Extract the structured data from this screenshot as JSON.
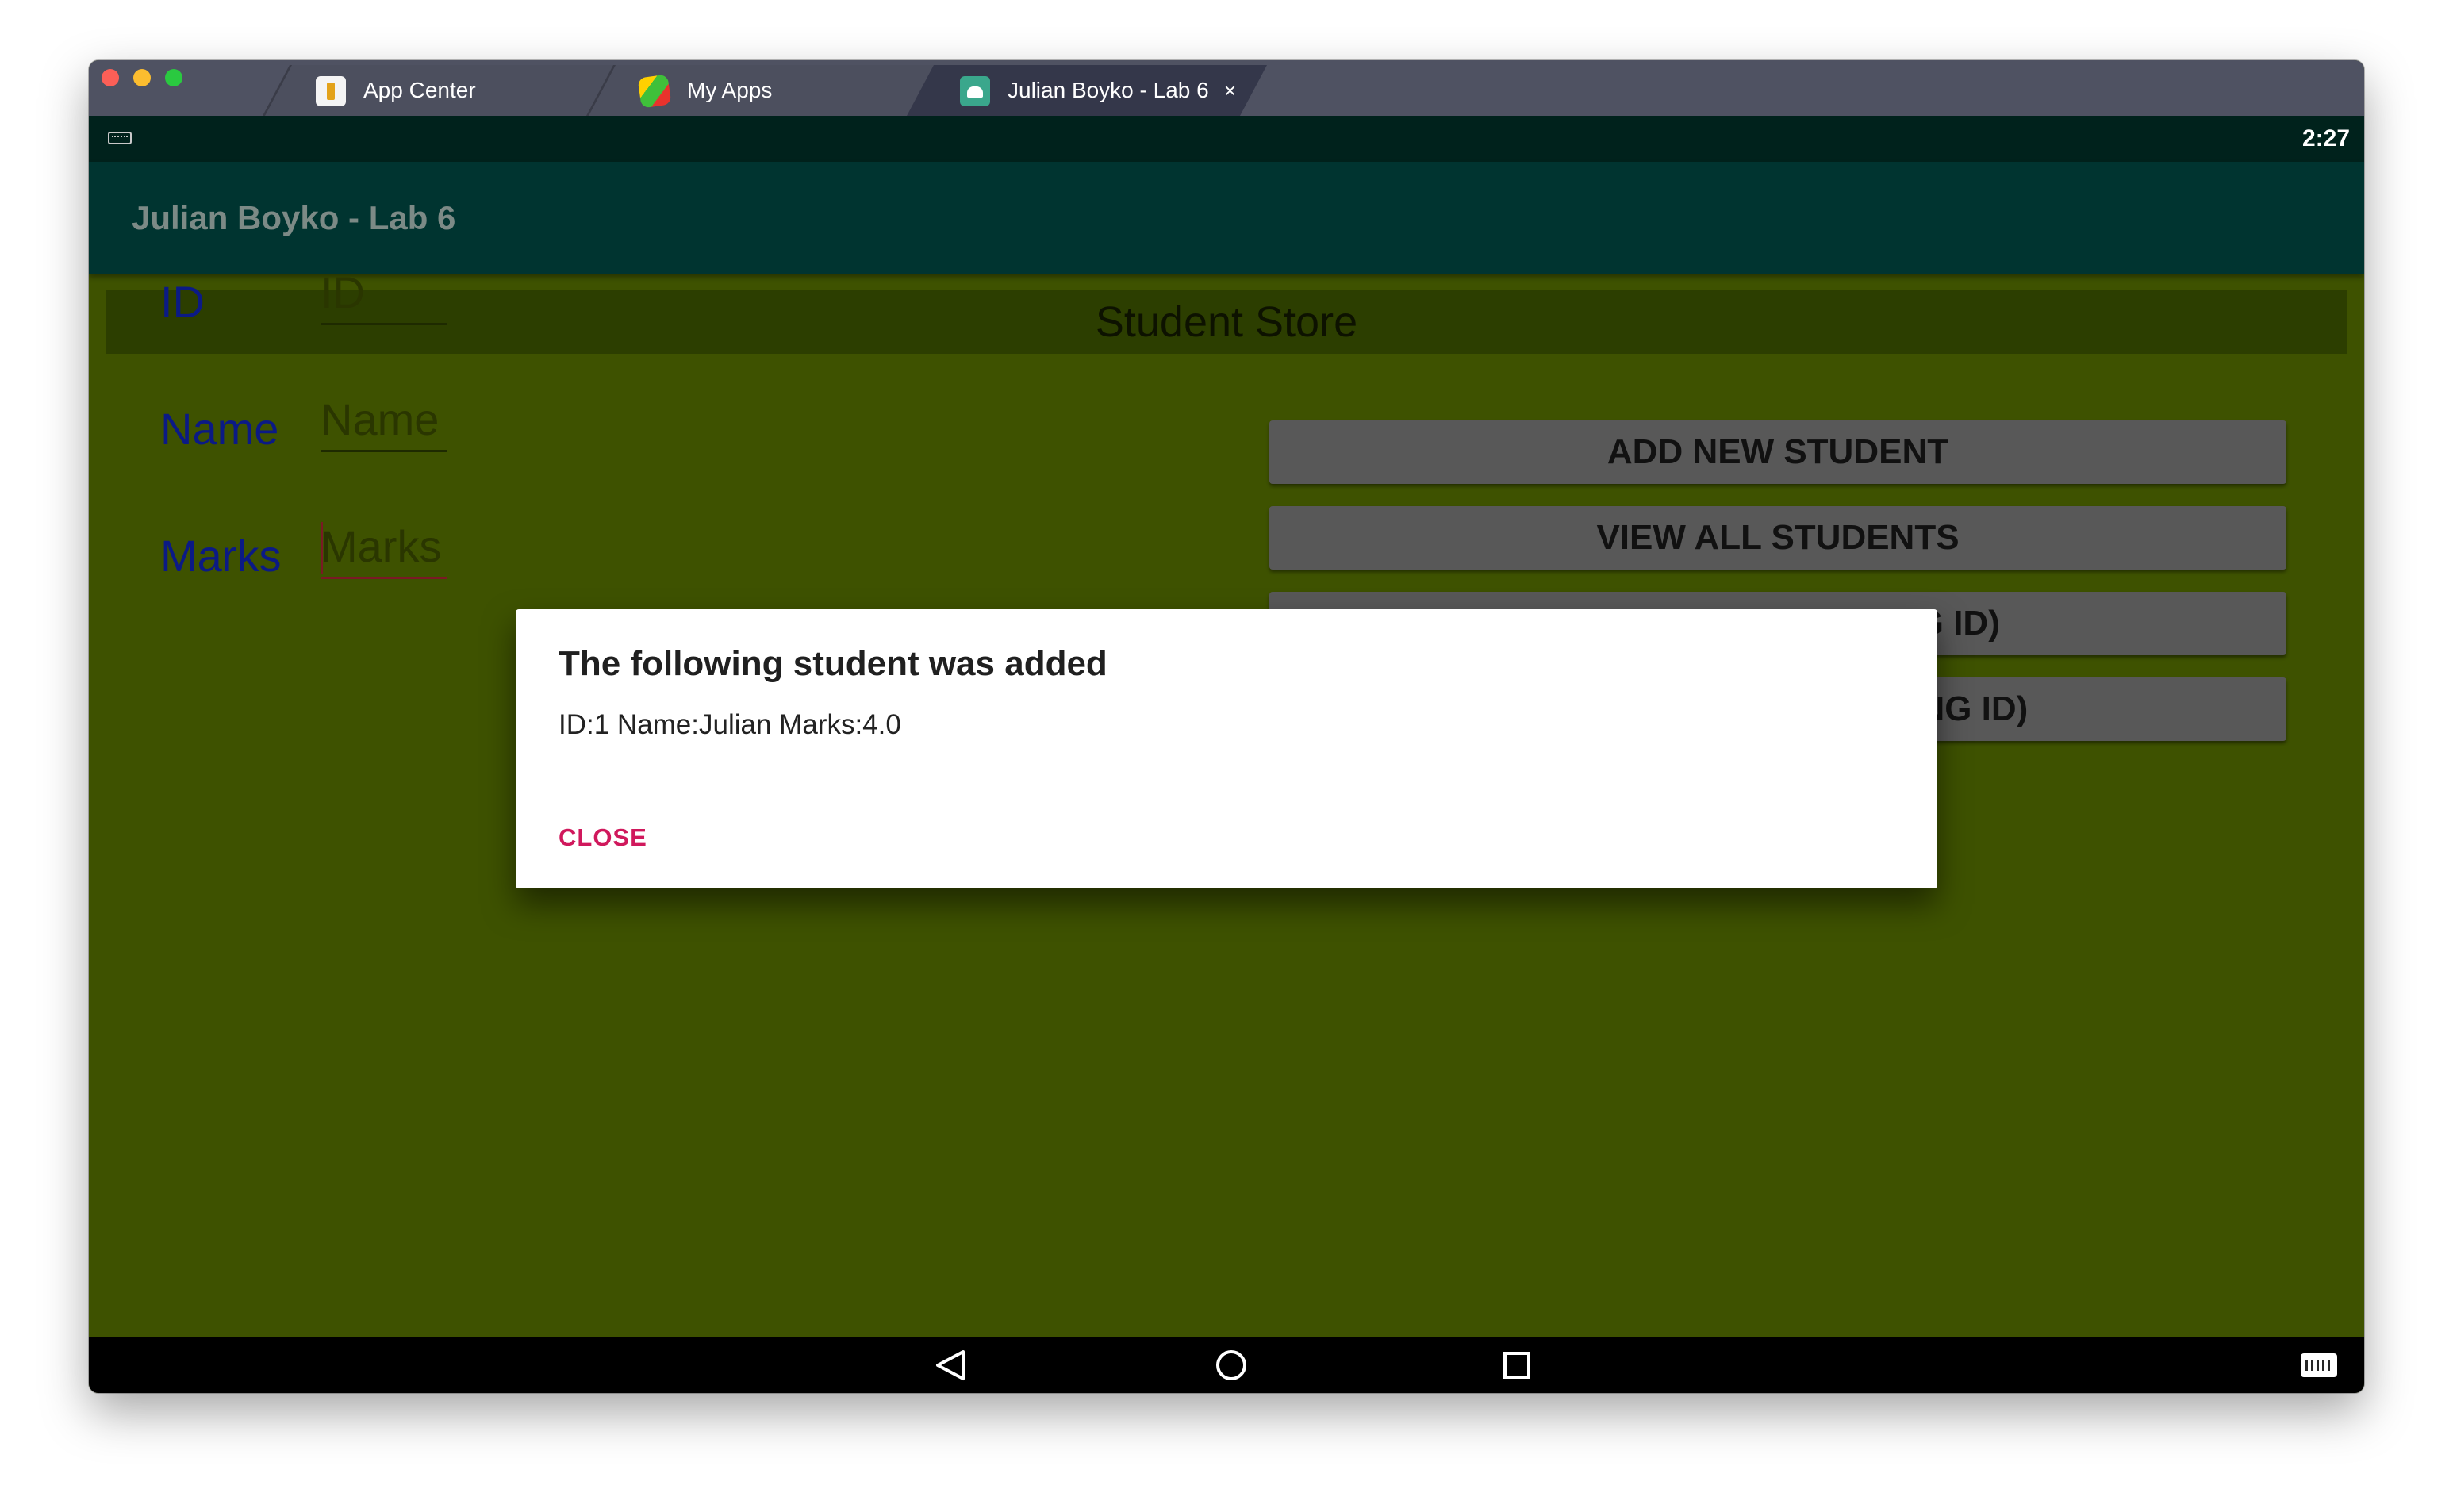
{
  "tabs": [
    {
      "label": "App Center",
      "icon": "app-center-icon"
    },
    {
      "label": "My Apps",
      "icon": "my-apps-icon"
    },
    {
      "label": "Julian Boyko - Lab 6",
      "icon": "android-icon",
      "close": "×",
      "active": true
    }
  ],
  "status": {
    "time": "2:27"
  },
  "app": {
    "title": "Julian Boyko - Lab 6"
  },
  "store": {
    "header": "Student Store"
  },
  "form": {
    "id_label": "ID",
    "id_placeholder": "ID",
    "name_label": "Name",
    "name_placeholder": "Name",
    "marks_label": "Marks",
    "marks_placeholder": "Marks"
  },
  "actions": {
    "add": "ADD NEW STUDENT",
    "view": "VIEW ALL STUDENTS",
    "find": "FIND STUDENT (USING ID)",
    "delete": "DELETE STUDENT (USING ID)"
  },
  "dialog": {
    "title": "The following student was added",
    "message": "ID:1 Name:Julian Marks:4.0",
    "close": "CLOSE"
  },
  "colors": {
    "content_bg": "#3e5200",
    "appbar_bg": "#003430",
    "label": "#0b1a85",
    "accent": "#d0185c"
  }
}
